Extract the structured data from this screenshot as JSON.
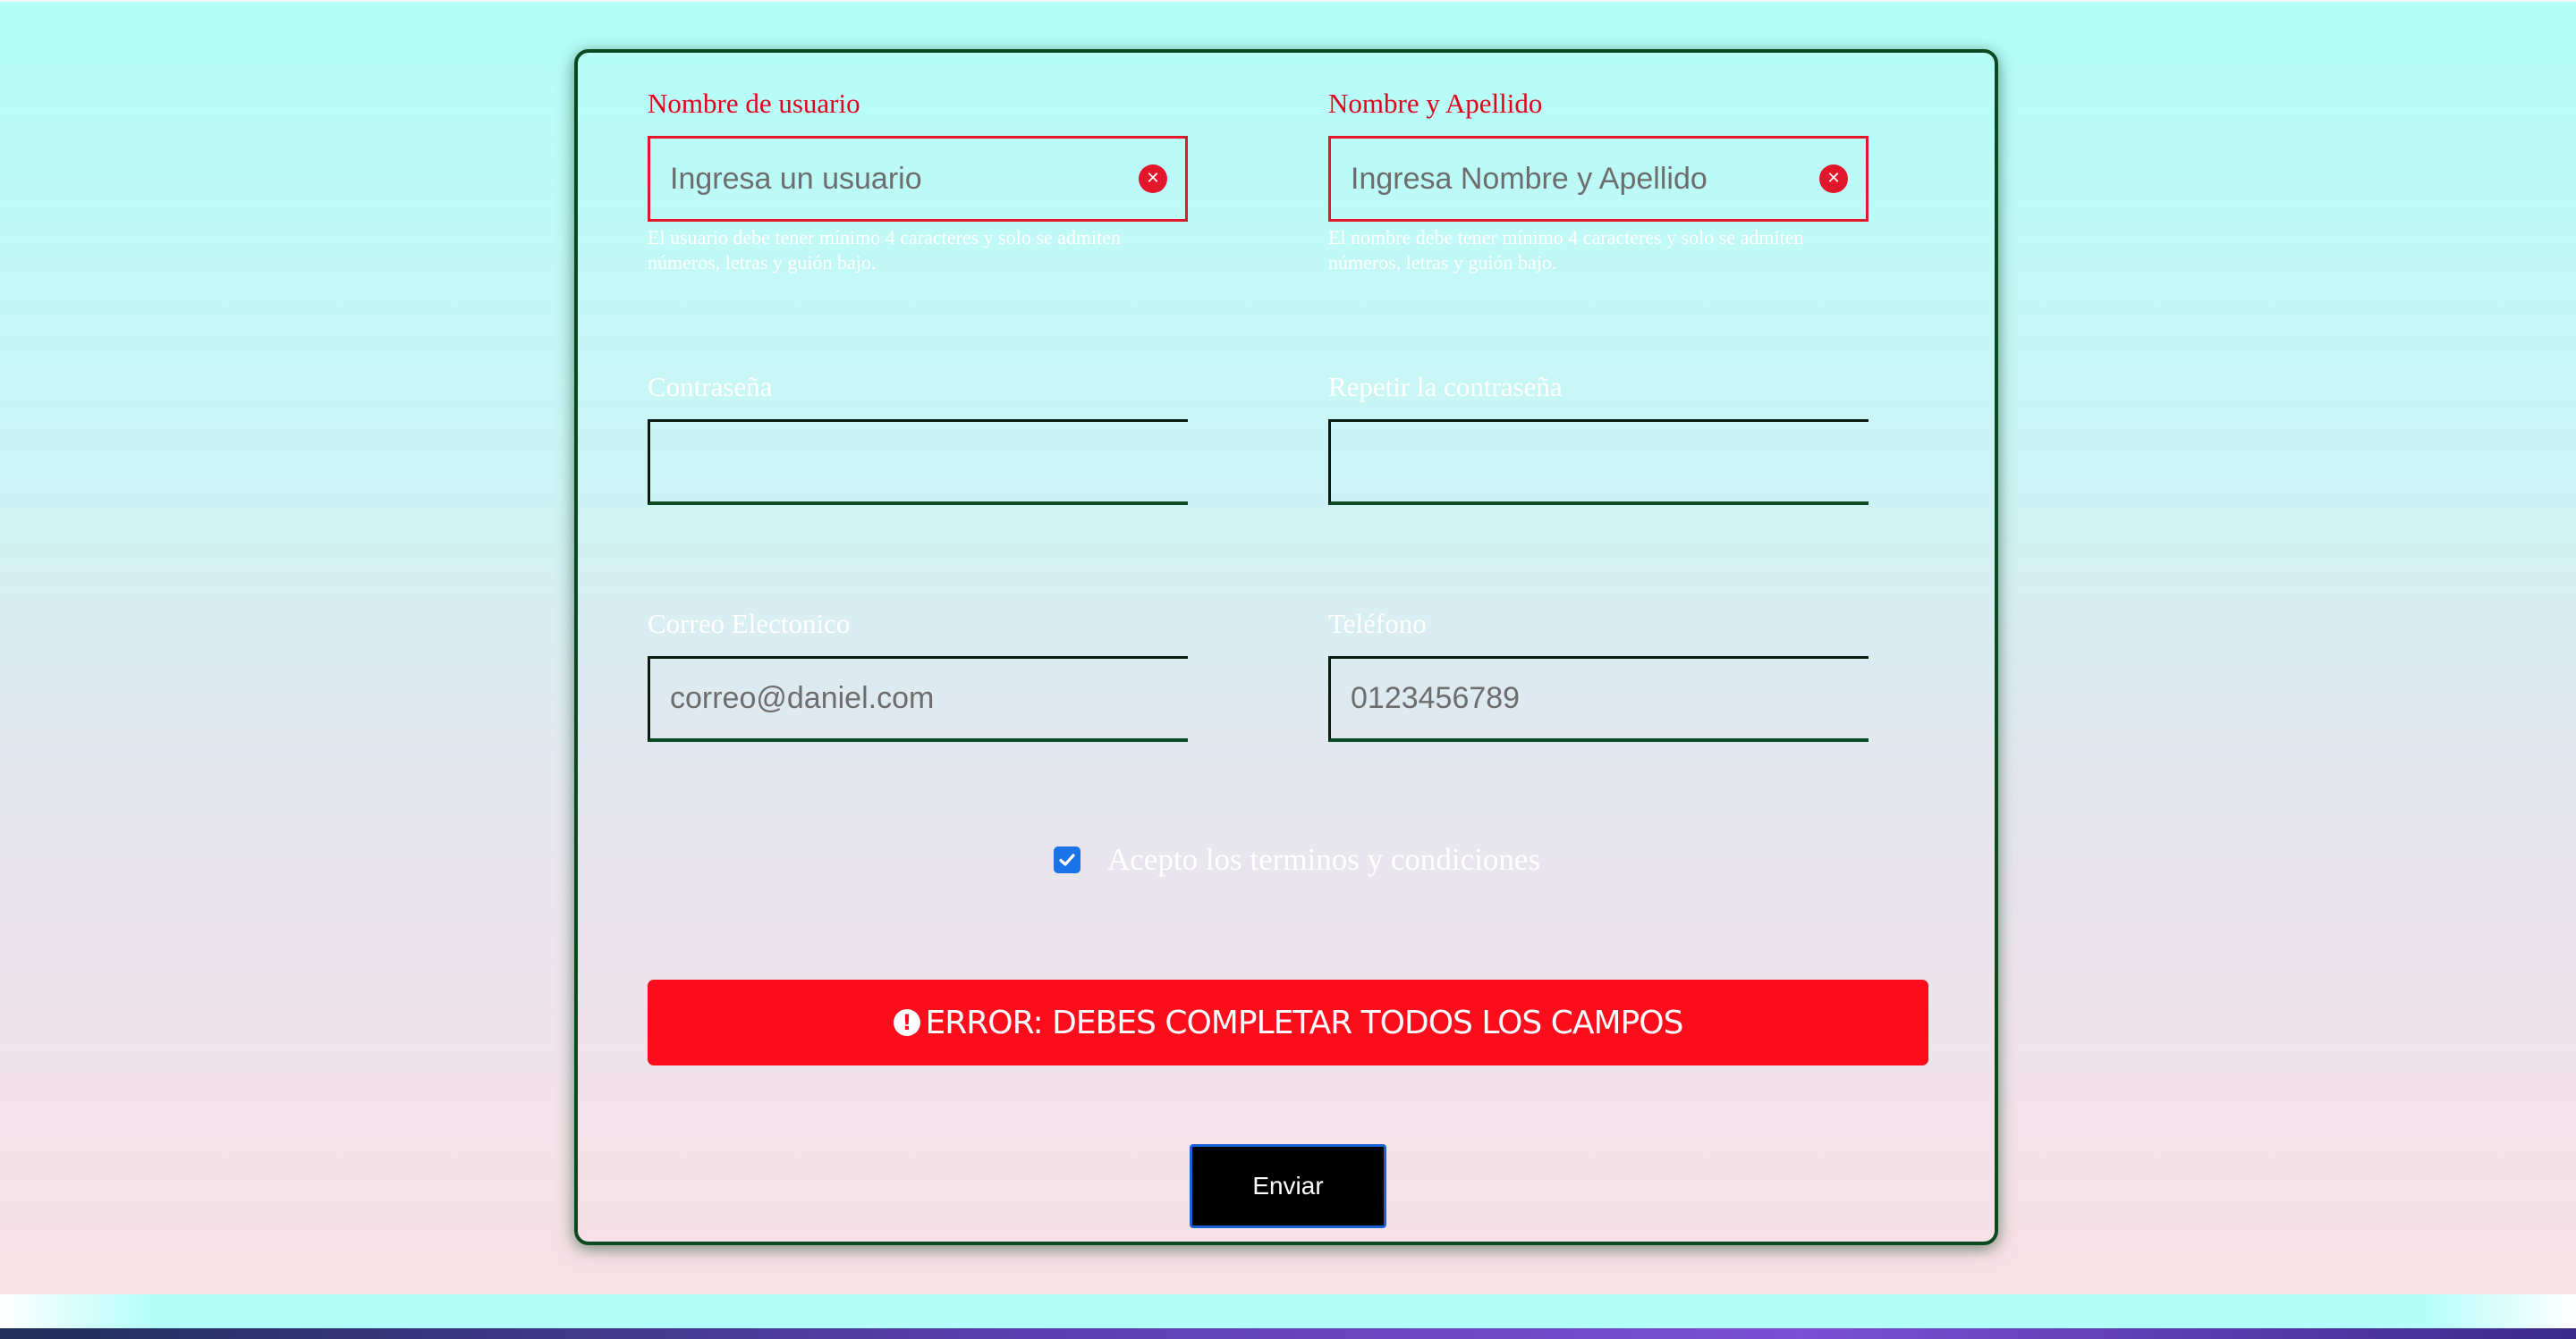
{
  "form": {
    "username": {
      "label": "Nombre de usuario",
      "placeholder": "Ingresa un usuario",
      "help": "El usuario debe tener mínimo 4 caracteres y solo se admiten números, letras y guión bajo."
    },
    "fullname": {
      "label": "Nombre y Apellido",
      "placeholder": "Ingresa Nombre y Apellido",
      "help": "El nombre debe tener mínimo 4 caracteres y solo se admiten números, letras y guión bajo."
    },
    "password": {
      "label": "Contraseña",
      "value": ""
    },
    "password_repeat": {
      "label": "Repetir la contraseña",
      "value": ""
    },
    "email": {
      "label": "Correo Electonico",
      "placeholder": "correo@daniel.com"
    },
    "phone": {
      "label": "Teléfono",
      "placeholder": "0123456789"
    },
    "terms": {
      "label": "Acepto los terminos y condiciones",
      "checked": true
    },
    "error_message": "ERROR: DEBES COMPLETAR TODOS LOS CAMPOS",
    "submit_label": "Enviar"
  },
  "colors": {
    "error": "#fd0c1c",
    "label_error": "#e3001b",
    "checkbox": "#1a73e8",
    "card_border": "#0a4a1e",
    "button_border": "#1b5fd6"
  },
  "icons": {
    "clear": "x-circle-icon",
    "error": "exclamation-circle-icon",
    "check": "checkmark-icon"
  }
}
